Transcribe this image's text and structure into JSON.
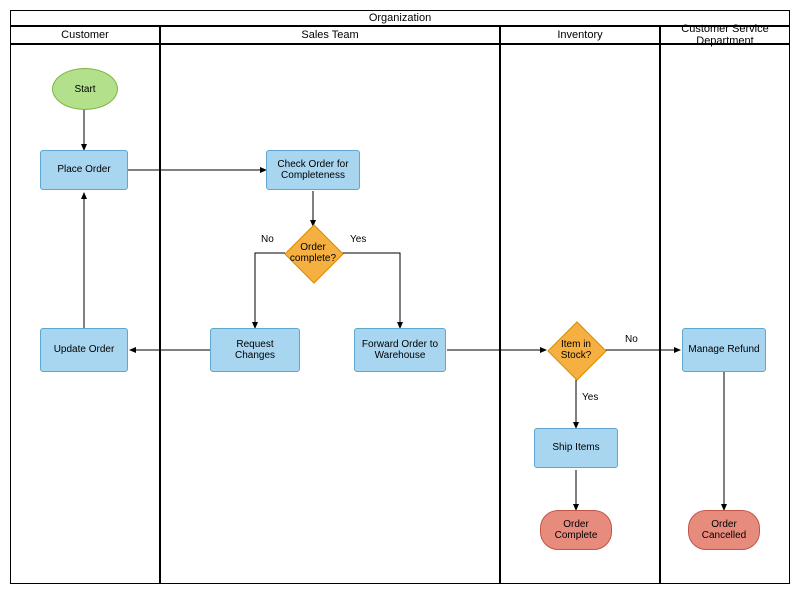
{
  "title": "Organization",
  "lanes": {
    "customer": "Customer",
    "sales": "Sales Team",
    "inventory": "Inventory",
    "cs": "Customer Service Department"
  },
  "nodes": {
    "start": "Start",
    "place_order": "Place Order",
    "check_order": "Check Order for Completeness",
    "order_complete_q": "Order complete?",
    "request_changes": "Request Changes",
    "update_order": "Update Order",
    "forward_order": "Forward Order to Warehouse",
    "item_in_stock": "Item in Stock?",
    "ship_items": "Ship Items",
    "order_complete": "Order Complete",
    "manage_refund": "Manage Refund",
    "order_cancelled": "Order Cancelled"
  },
  "edges": {
    "no": "No",
    "yes": "Yes"
  }
}
